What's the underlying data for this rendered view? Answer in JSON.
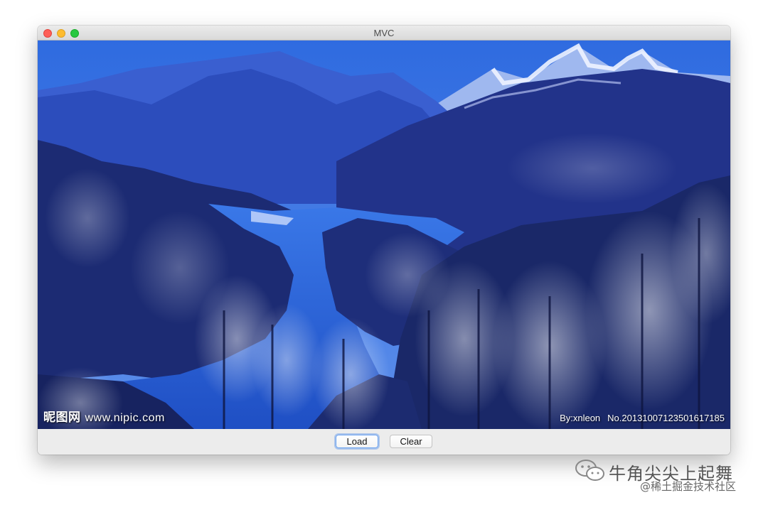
{
  "window": {
    "title": "MVC"
  },
  "image": {
    "watermark_left_brand": "昵图网",
    "watermark_left_site": "www.nipic.com",
    "watermark_right_by": "By:xnleon",
    "watermark_right_no": "No.20131007123501617185"
  },
  "buttons": {
    "load_label": "Load",
    "clear_label": "Clear"
  },
  "page_watermark": {
    "brand": "牛角尖尖上起舞",
    "sub": "@稀土掘金技术社区"
  },
  "colors": {
    "sky": "#2f6be0",
    "water": "#2b63e0",
    "forest": "#1b2a6a",
    "snow": "#dfe8ff",
    "window_bg": "#ececec"
  }
}
